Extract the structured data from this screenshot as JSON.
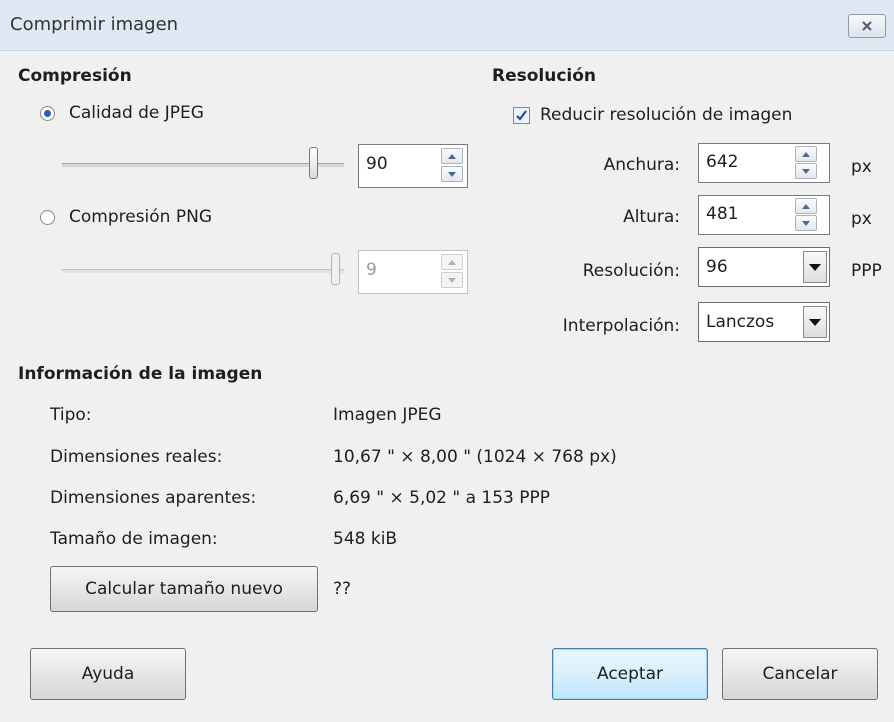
{
  "window": {
    "title": "Comprimir imagen",
    "close_icon": "close-icon"
  },
  "compression": {
    "group_title": "Compresión",
    "jpeg_label": "Calidad de JPEG",
    "jpeg_selected": true,
    "jpeg_quality": "90",
    "jpeg_quality_level": 0.9,
    "png_label": "Compresión PNG",
    "png_selected": false,
    "png_compression": "9",
    "png_compression_level": 1.0
  },
  "resolution": {
    "group_title": "Resolución",
    "reduce_label": "Reducir resolución de imagen",
    "reduce_checked": true,
    "width_label": "Anchura:",
    "width_value": "642",
    "width_unit": "px",
    "height_label": "Altura:",
    "height_value": "481",
    "height_unit": "px",
    "dpi_label": "Resolución:",
    "dpi_value": "96",
    "dpi_unit": "PPP",
    "interp_label": "Interpolación:",
    "interp_value": "Lanczos"
  },
  "image_info": {
    "group_title": "Información de la imagen",
    "rows": [
      {
        "label": "Tipo:",
        "value": "Imagen JPEG"
      },
      {
        "label": "Dimensiones reales:",
        "value": "10,67 \" × 8,00 \" (1024 × 768 px)"
      },
      {
        "label": "Dimensiones aparentes:",
        "value": "6,69 \" × 5,02 \" a 153 PPP"
      },
      {
        "label": "Tamaño de imagen:",
        "value": "548 kiB"
      }
    ],
    "calc_button": "Calcular tamaño nuevo",
    "new_size": "??"
  },
  "footer": {
    "help_button": "Ayuda",
    "accept_button": "Aceptar",
    "cancel_button": "Cancelar"
  },
  "colors": {
    "titlebar": "#dfe8f3",
    "background": "#f0f0f0",
    "accent": "#3c7fb1"
  }
}
